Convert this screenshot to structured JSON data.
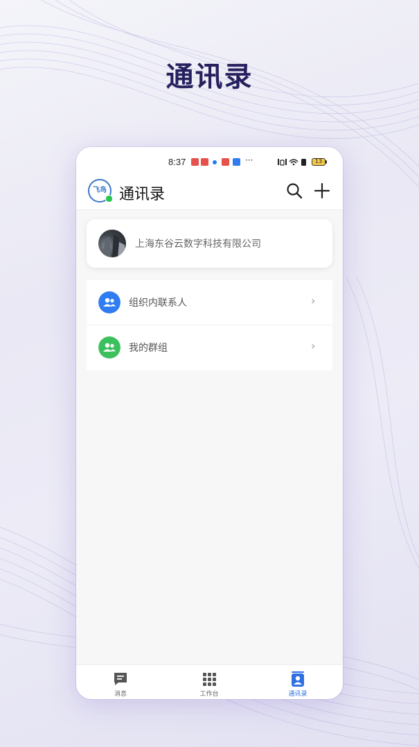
{
  "promo": {
    "title": "通讯录"
  },
  "status_bar": {
    "time": "8:37",
    "battery": "13",
    "ellipsis": "···"
  },
  "header": {
    "logo_text": "飞鸟",
    "title": "通讯录"
  },
  "org_card": {
    "name": "上海东谷云数字科技有限公司"
  },
  "menu": [
    {
      "label": "组织内联系人",
      "icon": "people-icon",
      "color": "#2f7df0"
    },
    {
      "label": "我的群组",
      "icon": "group-icon",
      "color": "#3cc05e"
    }
  ],
  "tabs": [
    {
      "label": "消息",
      "icon": "message-icon"
    },
    {
      "label": "工作台",
      "icon": "grid-icon"
    },
    {
      "label": "通讯录",
      "icon": "contacts-icon",
      "active": true
    }
  ],
  "colors": {
    "accent": "#2f6fdf",
    "title": "#26215e",
    "green": "#3cc05e"
  }
}
